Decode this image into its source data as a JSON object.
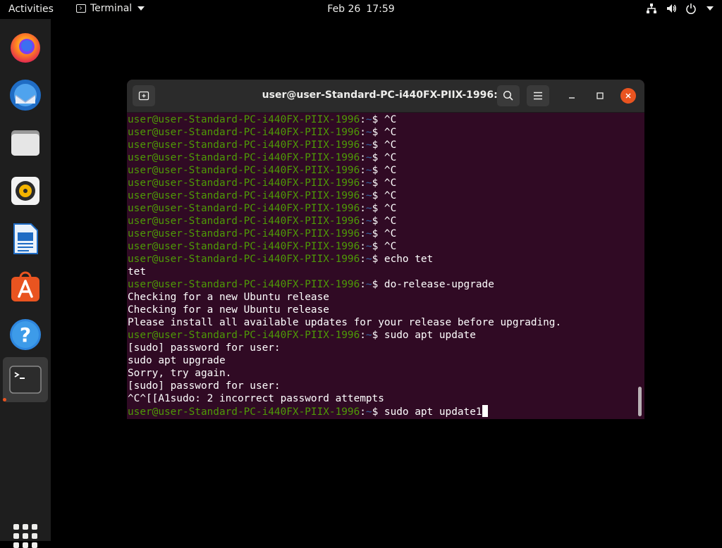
{
  "topbar": {
    "activities": "Activities",
    "app_name": "Terminal",
    "date": "Feb 26",
    "time": "17:59"
  },
  "dock": {
    "items": [
      {
        "name": "firefox-icon"
      },
      {
        "name": "thunderbird-icon"
      },
      {
        "name": "files-icon"
      },
      {
        "name": "rhythmbox-icon"
      },
      {
        "name": "libreoffice-writer-icon"
      },
      {
        "name": "ubuntu-software-icon"
      },
      {
        "name": "help-icon"
      },
      {
        "name": "terminal-icon"
      }
    ],
    "show_apps": "show-applications-icon"
  },
  "window": {
    "title": "user@user-Standard-PC-i440FX-PIIX-1996: ~"
  },
  "terminal": {
    "user_host": "user@user-Standard-PC-i440FX-PIIX-1996",
    "path": "~",
    "lines": [
      {
        "type": "prompt",
        "cmd": "^C"
      },
      {
        "type": "prompt",
        "cmd": "^C"
      },
      {
        "type": "prompt",
        "cmd": "^C"
      },
      {
        "type": "prompt",
        "cmd": "^C"
      },
      {
        "type": "prompt",
        "cmd": "^C"
      },
      {
        "type": "prompt",
        "cmd": "^C"
      },
      {
        "type": "prompt",
        "cmd": "^C"
      },
      {
        "type": "prompt",
        "cmd": "^C"
      },
      {
        "type": "prompt",
        "cmd": "^C"
      },
      {
        "type": "prompt",
        "cmd": "^C"
      },
      {
        "type": "prompt",
        "cmd": "^C"
      },
      {
        "type": "prompt",
        "cmd": "echo tet"
      },
      {
        "type": "output",
        "text": "tet"
      },
      {
        "type": "prompt",
        "cmd": "do-release-upgrade"
      },
      {
        "type": "output",
        "text": "Checking for a new Ubuntu release"
      },
      {
        "type": "output",
        "text": "Checking for a new Ubuntu release"
      },
      {
        "type": "output",
        "text": "Please install all available updates for your release before upgrading."
      },
      {
        "type": "prompt",
        "cmd": "sudo apt update"
      },
      {
        "type": "output",
        "text": "[sudo] password for user:"
      },
      {
        "type": "output",
        "text": "sudo apt upgrade"
      },
      {
        "type": "output",
        "text": "Sorry, try again."
      },
      {
        "type": "output",
        "text": "[sudo] password for user:"
      },
      {
        "type": "output",
        "text": "^C^[[A1sudo: 2 incorrect password attempts"
      },
      {
        "type": "prompt",
        "cmd": "sudo apt update1",
        "cursor": true
      }
    ]
  },
  "colors": {
    "terminal_bg": "#300a24",
    "prompt_user": "#4e9a06",
    "prompt_path": "#3465a4",
    "close_button": "#e95420"
  }
}
